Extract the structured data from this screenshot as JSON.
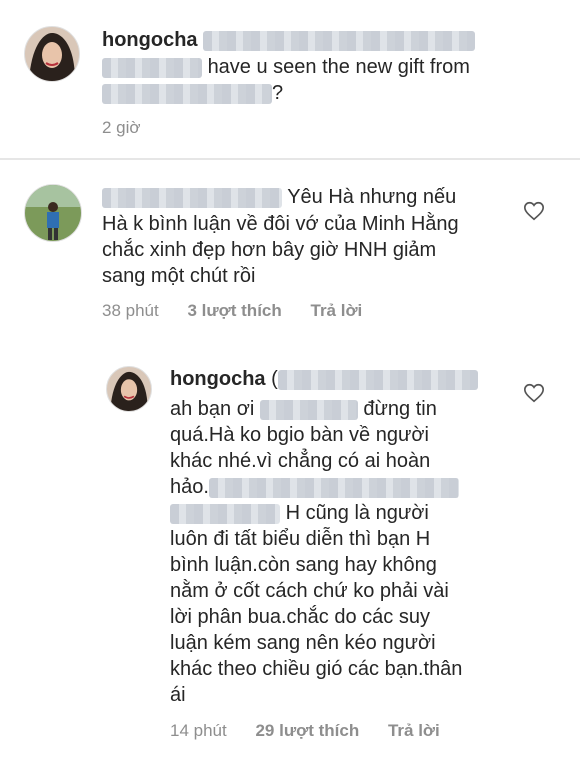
{
  "post_caption": {
    "username": "hongocha",
    "line1": "have u seen the new gift from",
    "line2_end": "?",
    "time": "2 giờ"
  },
  "comment1": {
    "lines": [
      "Yêu Hà nhưng nếu",
      "Hà k bình luận về đôi vớ của Minh Hằng",
      "chắc xinh đẹp hơn bây giờ HNH giảm",
      "sang một chút rồi"
    ],
    "time": "38 phút",
    "likes": "3 lượt thích",
    "reply": "Trả lời"
  },
  "reply1": {
    "username": "hongocha",
    "line1_prefix": "(",
    "line2_start": "ah bạn ơi",
    "line2_end": "đừng tin",
    "lines_mid": [
      "quá.Hà ko bgio bàn về người",
      "khác nhé.vì chẳng có ai hoàn",
      "hảo."
    ],
    "line6_end": "H cũng là người",
    "lines_end": [
      "luôn đi tất biểu diễn thì bạn H",
      "bình luận.còn sang hay không",
      "nằm ở cốt cách chứ ko phải vài",
      "lời phân bua.chắc do các suy",
      "luận kém sang nên kéo người",
      "khác theo chiều gió các bạn.thân",
      "ái"
    ],
    "time": "14 phút",
    "likes": "29 lượt thích",
    "reply": "Trả lời"
  },
  "icons": {
    "like": "heart-outline-icon"
  }
}
